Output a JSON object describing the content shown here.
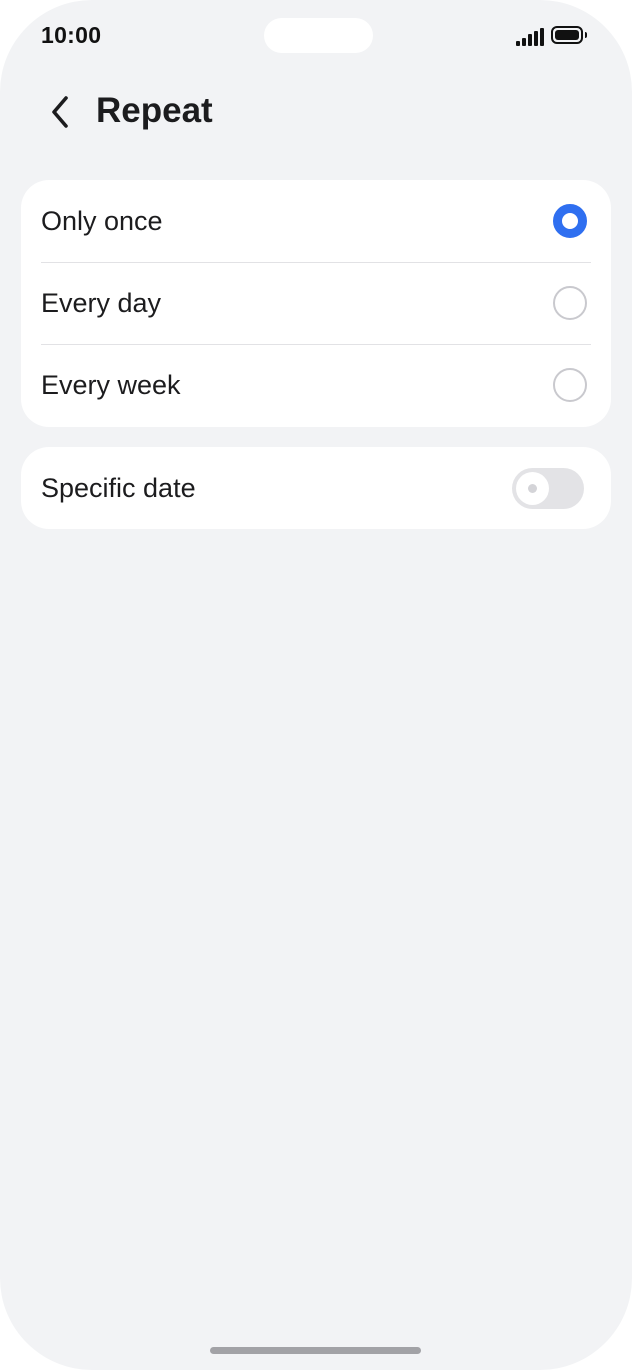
{
  "status_bar": {
    "time": "10:00",
    "signal_icon": "cellular-signal-icon",
    "battery_icon": "battery-full-icon"
  },
  "header": {
    "back_icon": "chevron-left-icon",
    "title": "Repeat"
  },
  "repeat_options": {
    "items": [
      {
        "label": "Only once",
        "selected": true
      },
      {
        "label": "Every day",
        "selected": false
      },
      {
        "label": "Every week",
        "selected": false
      }
    ]
  },
  "specific_date": {
    "label": "Specific date",
    "enabled": false
  },
  "colors": {
    "accent": "#2f6ff0",
    "background": "#f2f3f5",
    "card": "#ffffff"
  }
}
